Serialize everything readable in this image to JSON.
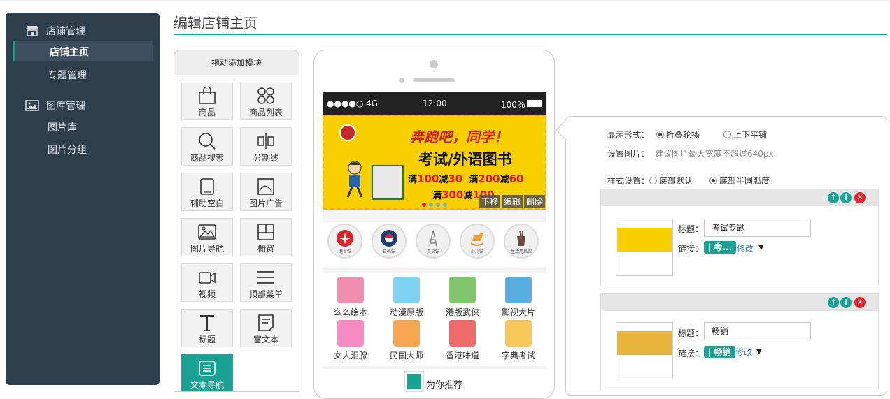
{
  "sidebar": {
    "groups": [
      {
        "label": "店铺管理",
        "icon": "store-icon",
        "items": [
          "店铺主页",
          "专题管理"
        ]
      },
      {
        "label": "图库管理",
        "icon": "image-icon",
        "items": [
          "图片库",
          "图片分组"
        ]
      }
    ],
    "active_item": "店铺主页"
  },
  "page": {
    "title": "编辑店铺主页"
  },
  "palette": {
    "header": "拖动添加模块",
    "modules": [
      {
        "label": "商品",
        "icon": "shopping-bag-icon"
      },
      {
        "label": "商品列表",
        "icon": "circles-grid-icon"
      },
      {
        "label": "商品搜索",
        "icon": "search-icon"
      },
      {
        "label": "分割线",
        "icon": "divider-icon"
      },
      {
        "label": "辅助空白",
        "icon": "blank-space-icon"
      },
      {
        "label": "图片广告",
        "icon": "image-ad-icon"
      },
      {
        "label": "图片导航",
        "icon": "image-nav-icon"
      },
      {
        "label": "橱窗",
        "icon": "window-icon"
      },
      {
        "label": "视频",
        "icon": "video-icon"
      },
      {
        "label": "顶部菜单",
        "icon": "menu-icon"
      },
      {
        "label": "标题",
        "icon": "title-icon"
      },
      {
        "label": "富文本",
        "icon": "rich-text-icon"
      },
      {
        "label": "文本导航",
        "icon": "text-nav-icon"
      }
    ]
  },
  "phone": {
    "status": {
      "signal": "●●●●○ 4G",
      "time": "12:00",
      "battery": "100％"
    },
    "banner": {
      "headline": "奔跑吧，同学！",
      "title": "考试/外语图书",
      "offer_line1_a": "满",
      "offer_line1_b": "100",
      "offer_line1_c": "减",
      "offer_line1_d": "30",
      "offer_line1_e": "满",
      "offer_line1_f": "200",
      "offer_line1_g": "减",
      "offer_line1_h": "60",
      "offer_line2_a": "满",
      "offer_line2_b": "300",
      "offer_line2_c": "减",
      "offer_line2_d": "100",
      "actions": [
        "下移",
        "编辑",
        "删除"
      ]
    },
    "circle_nav": [
      {
        "label": "港台馆",
        "icon": "flower-flag-icon"
      },
      {
        "label": "日韩馆",
        "icon": "yin-yang-icon"
      },
      {
        "label": "英文馆",
        "icon": "tower-icon"
      },
      {
        "label": "少儿馆",
        "icon": "rocking-horse-icon"
      },
      {
        "label": "生活用品馆",
        "icon": "utensils-icon"
      }
    ],
    "grid": [
      {
        "label": "么么绘本",
        "color": "#f08fb0"
      },
      {
        "label": "动漫原版",
        "color": "#7fd3f0"
      },
      {
        "label": "港版武侠",
        "color": "#7fc66a"
      },
      {
        "label": "影视大片",
        "color": "#5aaee0"
      },
      {
        "label": "女人泪腺",
        "color": "#f48bc3"
      },
      {
        "label": "民国大师",
        "color": "#f6a650"
      },
      {
        "label": "香港味道",
        "color": "#f26b6b"
      },
      {
        "label": "字典考试",
        "color": "#f7c75a"
      }
    ],
    "recommend": "为你推荐"
  },
  "settings": {
    "display_label": "显示形式：",
    "display_options": [
      "折叠轮播",
      "上下平铺"
    ],
    "display_selected": 0,
    "image_label": "设置图片：",
    "image_hint": "建议图片最大宽度不超过640px",
    "style_label": "样式设置：",
    "style_options": [
      "底部默认",
      "底部半圆弧度"
    ],
    "style_selected": 1,
    "cards": [
      {
        "title_label": "标题：",
        "title_value": "考试专题",
        "link_label": "链接：",
        "link_tag": "| 考...",
        "edit": "修改"
      },
      {
        "title_label": "标题：",
        "title_value": "畅销",
        "link_label": "链接：",
        "link_tag": "| 畅销",
        "edit": "修改"
      }
    ]
  },
  "colors": {
    "accent": "#1aa394",
    "sidebar_bg": "#2f3e4d"
  }
}
